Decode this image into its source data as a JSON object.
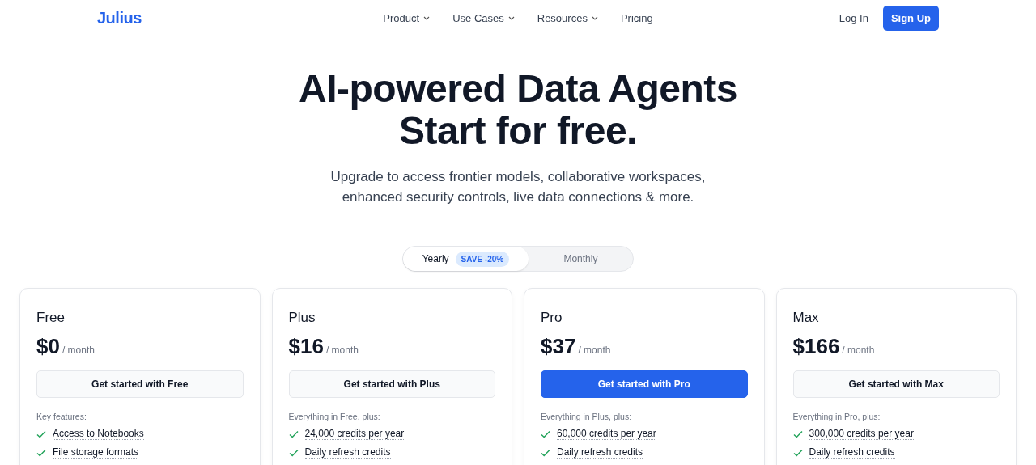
{
  "nav": {
    "logo": "Julius",
    "menu": [
      {
        "label": "Product",
        "dropdown": true
      },
      {
        "label": "Use Cases",
        "dropdown": true
      },
      {
        "label": "Resources",
        "dropdown": true
      },
      {
        "label": "Pricing",
        "dropdown": false
      }
    ],
    "login": "Log In",
    "signup": "Sign Up"
  },
  "hero": {
    "title_lines": [
      "AI-powered Data Agents",
      "Start for free."
    ],
    "subtitle_lines": [
      "Upgrade to access frontier models, collaborative workspaces,",
      "enhanced security controls, live data connections & more."
    ]
  },
  "billing_toggle": [
    {
      "label": "Yearly",
      "badge": "SAVE -20%",
      "selected": true
    },
    {
      "label": "Monthly",
      "selected": false
    }
  ],
  "plans": [
    {
      "name": "Free",
      "price": "$0",
      "period": "/ month",
      "button": "Get started with Free",
      "highlighted": false,
      "features_intro": "Key features:",
      "features": [
        "Access to Notebooks",
        "File storage formats"
      ]
    },
    {
      "name": "Plus",
      "price": "$16",
      "period": "/ month",
      "button": "Get started with Plus",
      "highlighted": false,
      "features_intro": "Everything in Free, plus:",
      "features": [
        "24,000 credits per year",
        "Daily refresh credits"
      ]
    },
    {
      "name": "Pro",
      "price": "$37",
      "period": "/ month",
      "button": "Get started with Pro",
      "highlighted": true,
      "features_intro": "Everything in Plus, plus:",
      "features": [
        "60,000 credits per year",
        "Daily refresh credits"
      ]
    },
    {
      "name": "Max",
      "price": "$166",
      "period": "/ month",
      "button": "Get started with Max",
      "highlighted": false,
      "features_intro": "Everything in Pro, plus:",
      "features": [
        "300,000 credits per year",
        "Daily refresh credits"
      ]
    }
  ]
}
